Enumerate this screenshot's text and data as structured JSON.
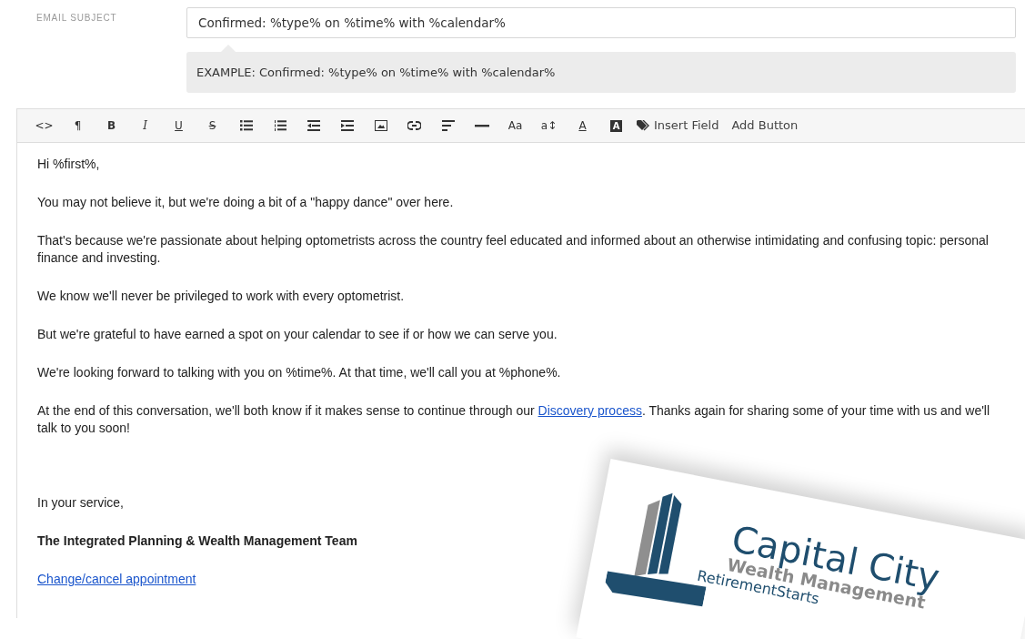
{
  "subject": {
    "label": "EMAIL SUBJECT",
    "value": "Confirmed: %type% on %time% with %calendar%",
    "example": "EXAMPLE: Confirmed: %type% on %time% with %calendar%"
  },
  "toolbar": [
    {
      "kind": "glyph",
      "label": "<>"
    },
    {
      "kind": "glyph",
      "label": "¶"
    },
    {
      "kind": "bold",
      "label": "B"
    },
    {
      "kind": "italic",
      "label": "I"
    },
    {
      "kind": "underline",
      "label": "U"
    },
    {
      "kind": "strike",
      "label": "S"
    },
    {
      "kind": "ul"
    },
    {
      "kind": "ol"
    },
    {
      "kind": "outdent"
    },
    {
      "kind": "indent"
    },
    {
      "kind": "image"
    },
    {
      "kind": "link"
    },
    {
      "kind": "align"
    },
    {
      "kind": "rule"
    },
    {
      "kind": "glyph",
      "label": "Aa"
    },
    {
      "kind": "glyph",
      "label": "a↕"
    },
    {
      "kind": "underline",
      "label": "A"
    },
    {
      "kind": "inverse",
      "label": "A"
    },
    {
      "kind": "tag",
      "label": "Insert Field"
    },
    {
      "kind": "text",
      "label": "Add Button"
    }
  ],
  "body": [
    {
      "kind": "text",
      "parts": [
        {
          "text": "Hi %first%,",
          "kind": "text"
        }
      ]
    },
    {
      "kind": "text",
      "parts": [
        {
          "text": "You may not believe it, but we're doing a bit of a \"happy dance\" over here.",
          "kind": "text"
        }
      ]
    },
    {
      "kind": "text",
      "parts": [
        {
          "text": "That's because we're passionate about helping optometrists across the country feel educated and informed about an otherwise intimidating and confusing topic: personal finance and investing.",
          "kind": "text"
        }
      ]
    },
    {
      "kind": "text",
      "parts": [
        {
          "text": "We know we'll never be privileged to work with every optometrist.",
          "kind": "text"
        }
      ]
    },
    {
      "kind": "text",
      "parts": [
        {
          "text": "But we're grateful to have earned a spot on your calendar to see if or how we can serve you.",
          "kind": "text"
        }
      ]
    },
    {
      "kind": "text",
      "parts": [
        {
          "text": "We're looking forward to talking with you on %time%. At that time, we'll call you at %phone%.",
          "kind": "text"
        }
      ]
    },
    {
      "kind": "text",
      "parts": [
        {
          "text": "At the end of this conversation, we'll both know if it makes sense to continue through our ",
          "kind": "text"
        },
        {
          "text": "Discovery process",
          "kind": "link"
        },
        {
          "text": ". Thanks again for sharing some of your time with us and we'll talk to you soon!",
          "kind": "text"
        }
      ]
    },
    {
      "kind": "spacer"
    },
    {
      "kind": "text",
      "parts": [
        {
          "text": "In your service,",
          "kind": "text"
        }
      ]
    },
    {
      "kind": "bold",
      "parts": [
        {
          "text": "The Integrated Planning & Wealth Management Team",
          "kind": "text"
        }
      ]
    },
    {
      "kind": "text",
      "parts": [
        {
          "text": "Change/cancel appointment",
          "kind": "link"
        }
      ]
    }
  ],
  "logo_card": {
    "name": "Capital City",
    "line_2": "Wealth Management",
    "line_3": "RetirementStarts"
  }
}
